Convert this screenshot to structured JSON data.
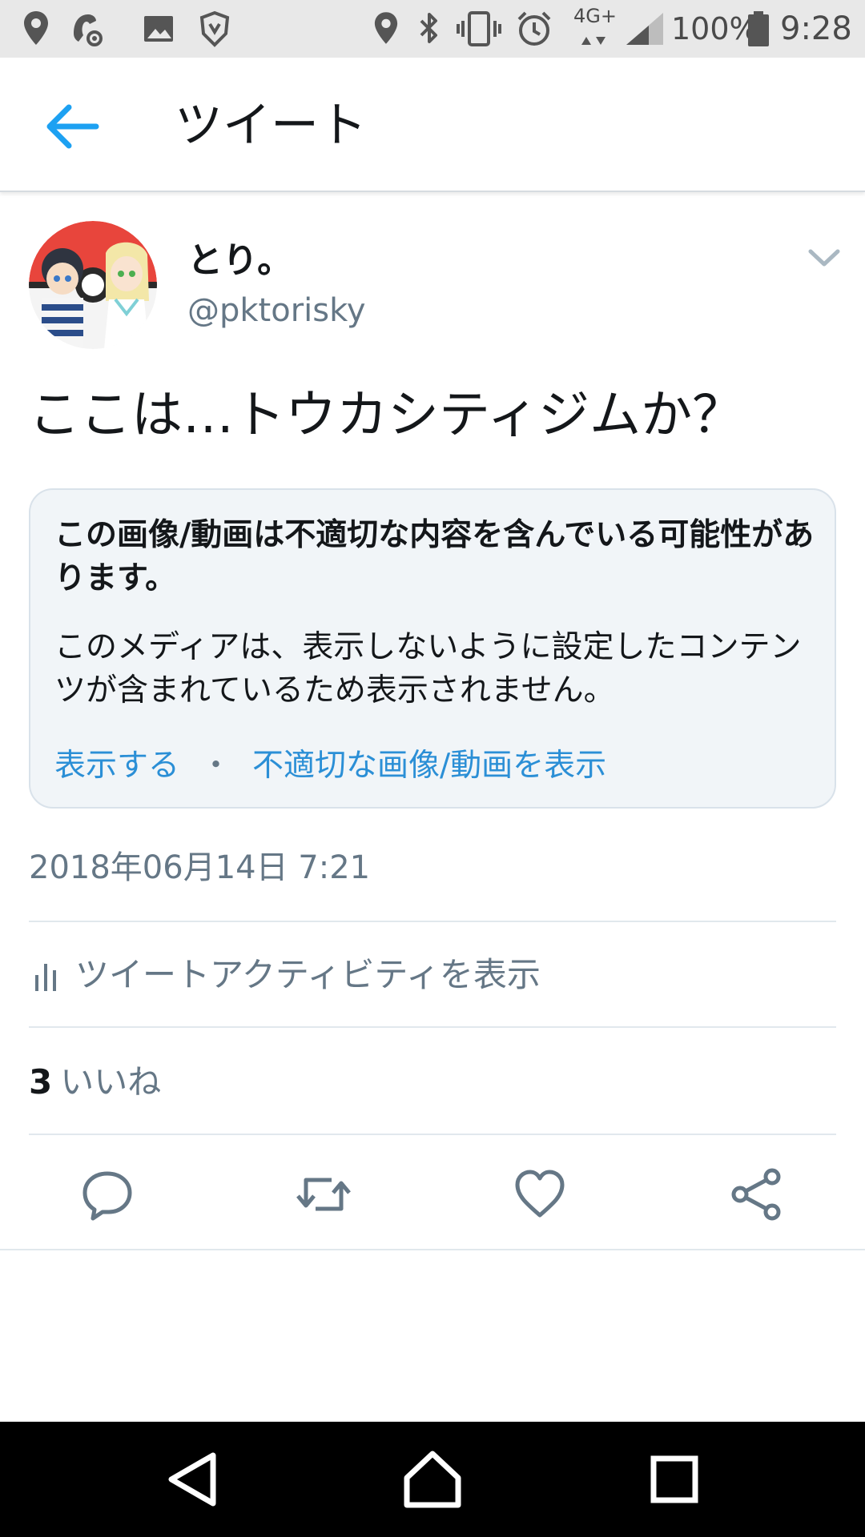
{
  "status_bar": {
    "battery": "100%",
    "network": "4G+",
    "time": "9:28",
    "left_icons": [
      "location-icon",
      "ringtone-settings-icon",
      "image-icon",
      "shield-app-icon"
    ],
    "right_icons": [
      "location-icon",
      "bluetooth-icon",
      "vibrate-icon",
      "alarm-icon",
      "signal-icon",
      "battery-icon"
    ]
  },
  "header": {
    "title": "ツイート",
    "back_icon": "arrow-left-icon",
    "accent_color": "#1da1f2"
  },
  "tweet": {
    "author_name": "とり。",
    "author_handle": "@pktorisky",
    "text": "ここは…トウカシティジムか？",
    "sensitive": {
      "title": "この画像/動画は不適切な内容を含んでいる可能性があります。",
      "body": "このメディアは、表示しないように設定したコンテンツが含まれているため表示されません。",
      "show_link": "表示する",
      "separator": "・",
      "settings_link": "不適切な画像/動画を表示"
    },
    "timestamp": "2018年06月14日 7:21",
    "activity_label": "ツイートアクティビティを表示",
    "likes_count": "3",
    "likes_label": "いいね",
    "actions": [
      "reply-icon",
      "retweet-icon",
      "like-icon",
      "share-icon"
    ]
  },
  "nav_bar": {
    "buttons": [
      "back-triangle-icon",
      "home-icon",
      "recents-icon"
    ]
  }
}
